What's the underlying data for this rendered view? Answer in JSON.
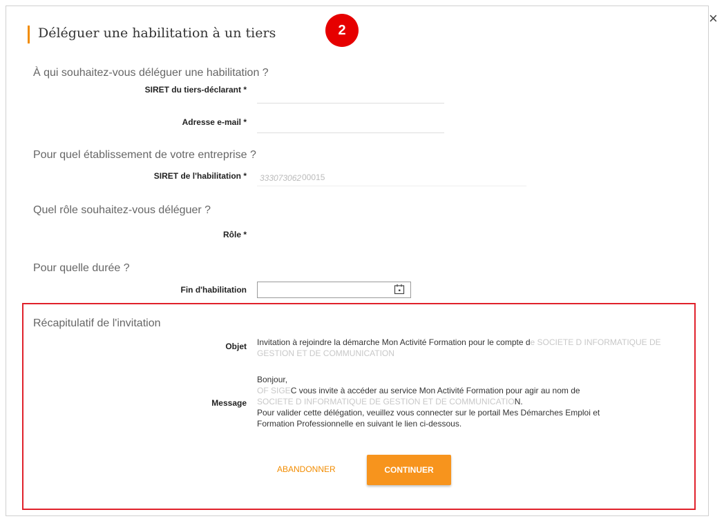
{
  "dialog": {
    "title": "Déléguer une habilitation à un tiers",
    "step_number": "2",
    "close_glyph": "×"
  },
  "who": {
    "section_title": "À qui souhaitez-vous déléguer une habilitation ?",
    "siret_label": "SIRET du tiers-déclarant *",
    "siret_value": "",
    "email_label": "Adresse e-mail *",
    "email_value": ""
  },
  "establishment": {
    "section_title": "Pour quel établissement de votre entreprise ?",
    "siret_label": "SIRET de l'habilitation *",
    "siret_prefix": "333073062",
    "siret_suffix": "00015"
  },
  "role": {
    "section_title": "Quel rôle souhaitez-vous déléguer ?",
    "label": "Rôle *"
  },
  "duration": {
    "section_title": "Pour quelle durée ?",
    "label": "Fin d'habilitation",
    "value": "",
    "icon": "calendar-icon"
  },
  "recap": {
    "section_title": "Récapitulatif de l'invitation",
    "object_label": "Objet",
    "object_text_1": "Invitation à rejoindre la démarche Mon Activité Formation pour le compte d",
    "object_text_faded": "e SOCIETE D INFORMATIQUE DE GESTION ET DE COMMUNICATION",
    "message_label": "Message",
    "greeting": "Bonjour,",
    "sender_faded": "OF SIGE",
    "sender_tail": "C vous invite à accéder au service Mon Activité Formation pour agir au nom de",
    "company_faded": "SOCIETE D INFORMATIQUE DE GESTION ET DE COMMUNICATIO",
    "company_tail": "N.",
    "line_validate": "Pour valider cette délégation, veuillez vous connecter sur le portail Mes Démarches Emploi et",
    "line_formation": "Formation Professionnelle en suivant le lien ci-dessous."
  },
  "actions": {
    "abandon": "ABANDONNER",
    "continue": "CONTINUER"
  },
  "colors": {
    "accent": "#f28c00",
    "badge": "#e60000",
    "highlight_border": "#e0202a"
  }
}
